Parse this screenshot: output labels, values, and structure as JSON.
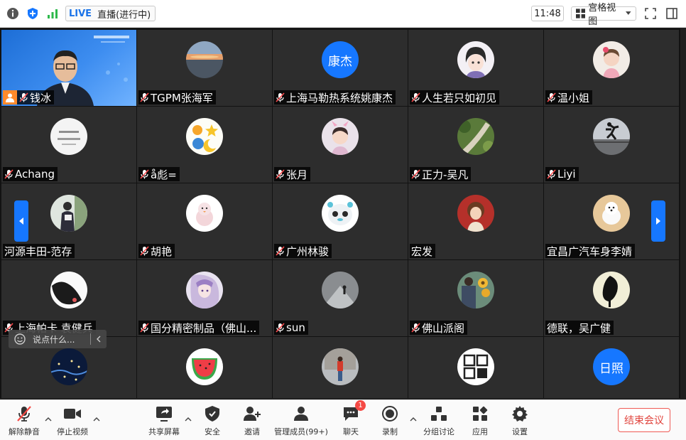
{
  "topbar": {
    "live_badge": "LIVE",
    "live_status": "直播(进行中)",
    "time": "11:48",
    "view_mode": "宫格视图"
  },
  "participants": [
    {
      "name": "钱冰",
      "muted": true,
      "host": true
    },
    {
      "name": "TGPM张海军",
      "muted": true
    },
    {
      "name": "上海马勒热系统姚康杰",
      "muted": true,
      "avatar_text": "康杰"
    },
    {
      "name": "人生若只如初见",
      "muted": true
    },
    {
      "name": "温小姐",
      "muted": true
    },
    {
      "name": "Achang",
      "muted": true
    },
    {
      "name": "å彪=",
      "muted": true
    },
    {
      "name": "张月",
      "muted": true
    },
    {
      "name": "正力-吴凡",
      "muted": true
    },
    {
      "name": "Liyi",
      "muted": true
    },
    {
      "name": "河源丰田-范存",
      "muted": false
    },
    {
      "name": "胡艳",
      "muted": true
    },
    {
      "name": "广州林骏",
      "muted": true
    },
    {
      "name": "宏发",
      "muted": false
    },
    {
      "name": "宜昌广汽车身李婧",
      "muted": false
    },
    {
      "name": "上海帕卡 袁健兵",
      "muted": true
    },
    {
      "name": "国分精密制品（佛山...",
      "muted": true
    },
    {
      "name": "sun",
      "muted": true
    },
    {
      "name": "佛山派阁",
      "muted": true
    },
    {
      "name": "德联，吴广健",
      "muted": false
    },
    {
      "name": "",
      "muted": true
    },
    {
      "name": "",
      "muted": true
    },
    {
      "name": "",
      "muted": true
    },
    {
      "name": "",
      "muted": true
    },
    {
      "name": "",
      "muted": true,
      "avatar_text": "日照"
    }
  ],
  "chat_placeholder": "说点什么...",
  "toolbar": {
    "unmute": "解除静音",
    "stop_video": "停止视频",
    "share_screen": "共享屏幕",
    "security": "安全",
    "invite": "邀请",
    "manage_members": "管理成员(99+)",
    "chat": "聊天",
    "chat_badge": "1",
    "record": "录制",
    "breakout": "分组讨论",
    "apps": "应用",
    "settings": "设置",
    "end_meeting": "结束会议"
  },
  "colors": {
    "accent": "#1677ff",
    "end": "#e0433c",
    "tile": "#2d2d2d"
  }
}
